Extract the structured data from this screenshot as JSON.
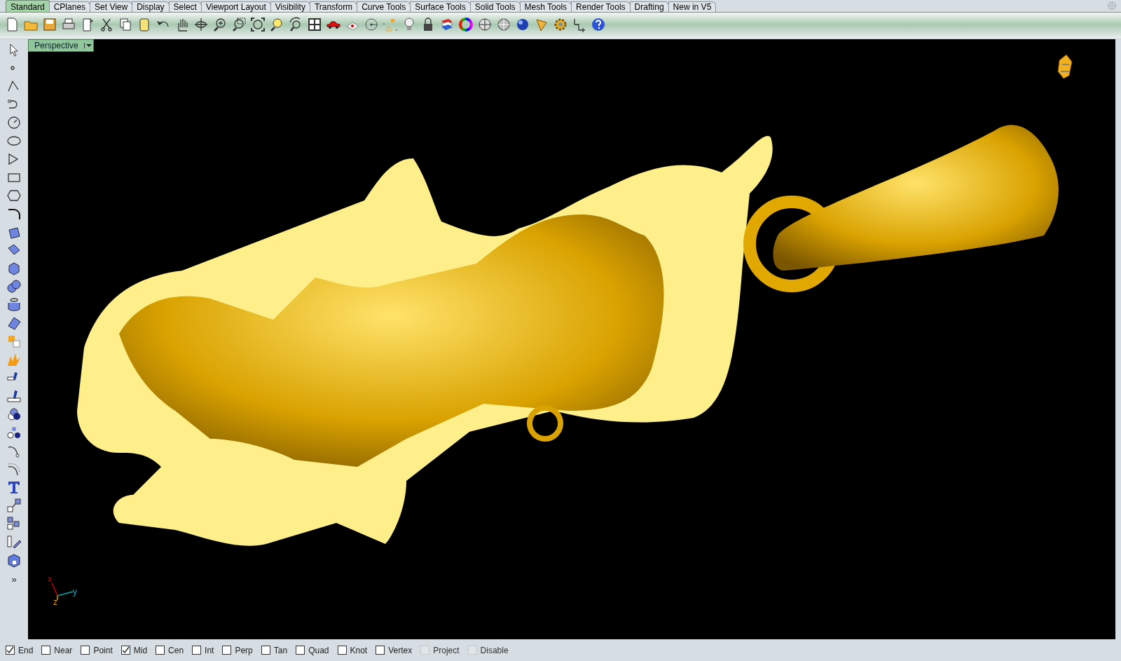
{
  "tabs": [
    {
      "label": "Standard",
      "selected": true
    },
    {
      "label": "CPlanes",
      "selected": false
    },
    {
      "label": "Set View",
      "selected": false
    },
    {
      "label": "Display",
      "selected": false
    },
    {
      "label": "Select",
      "selected": false
    },
    {
      "label": "Viewport Layout",
      "selected": false
    },
    {
      "label": "Visibility",
      "selected": false
    },
    {
      "label": "Transform",
      "selected": false
    },
    {
      "label": "Curve Tools",
      "selected": false
    },
    {
      "label": "Surface Tools",
      "selected": false
    },
    {
      "label": "Solid Tools",
      "selected": false
    },
    {
      "label": "Mesh Tools",
      "selected": false
    },
    {
      "label": "Render Tools",
      "selected": false
    },
    {
      "label": "Drafting",
      "selected": false
    },
    {
      "label": "New in V5",
      "selected": false
    }
  ],
  "viewport": {
    "title": "Perspective",
    "axes": {
      "x": "x",
      "y": "y",
      "z": "z"
    }
  },
  "osnaps": [
    {
      "label": "End",
      "checked": true,
      "disabled": false
    },
    {
      "label": "Near",
      "checked": false,
      "disabled": false
    },
    {
      "label": "Point",
      "checked": false,
      "disabled": false
    },
    {
      "label": "Mid",
      "checked": true,
      "disabled": false
    },
    {
      "label": "Cen",
      "checked": false,
      "disabled": false
    },
    {
      "label": "Int",
      "checked": false,
      "disabled": false
    },
    {
      "label": "Perp",
      "checked": false,
      "disabled": false
    },
    {
      "label": "Tan",
      "checked": false,
      "disabled": false
    },
    {
      "label": "Quad",
      "checked": false,
      "disabled": false
    },
    {
      "label": "Knot",
      "checked": false,
      "disabled": false
    },
    {
      "label": "Vertex",
      "checked": false,
      "disabled": false
    },
    {
      "label": "Project",
      "checked": false,
      "disabled": true
    },
    {
      "label": "Disable",
      "checked": false,
      "disabled": true
    }
  ],
  "left_toolbar": {
    "more": "»"
  }
}
